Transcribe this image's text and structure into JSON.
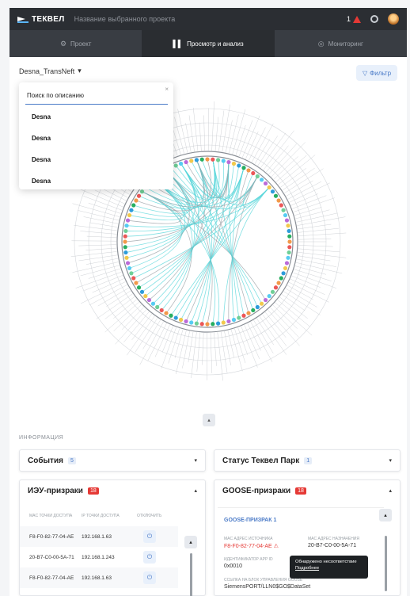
{
  "app": {
    "brand": "ТЕКВЕЛ",
    "project_name": "Название выбранного проекта",
    "alert_count": "1"
  },
  "nav": {
    "tabs": [
      {
        "label": "Проект"
      },
      {
        "label": "Просмотр и анализ"
      },
      {
        "label": "Мониторинг"
      }
    ]
  },
  "toolbar": {
    "project_select": "Desna_TransNeft",
    "filter_label": "Фильтр"
  },
  "search": {
    "placeholder": "Поиск по описанию",
    "options": [
      "Desna",
      "Desna",
      "Desna",
      "Desna"
    ]
  },
  "info": {
    "section_title": "ИНФОРМАЦИЯ",
    "events": {
      "title": "События",
      "count": "5"
    },
    "park_status": {
      "title": "Статус Теквел Парк",
      "count": "1"
    },
    "ied_ghosts": {
      "title": "ИЭУ-призраки",
      "count": "18",
      "columns": [
        "MAC ТОЧКИ ДОСТУПА",
        "IP ТОЧКИ ДОСТУПА",
        "ОТКЛЮЧИТЬ"
      ],
      "rows": [
        {
          "mac": "F8-F0-82-77-04-AE",
          "ip": "192.168.1.63"
        },
        {
          "mac": "20-B7-C0-00-5A-71",
          "ip": "192.168.1.243"
        },
        {
          "mac": "F8-F0-82-77-04-AE",
          "ip": "192.168.1.63"
        }
      ]
    },
    "goose_ghosts": {
      "title": "GOOSE-призраки",
      "count": "18",
      "item_title": "GOOSE-ПРИЗРАК 1",
      "src_label": "MAC АДРЕС ИСТОЧНИКА",
      "src_mac": "F8-F0-82-77-04-AE",
      "dst_label": "MAC АДРЕС НАЗНАЧЕНИЯ",
      "dst_mac": "20-B7-C0-00-5A-71",
      "appid_label": "ИДЕНТИФИКАТОР APP ID",
      "appid": "0x0010",
      "gcb_label": "ССЫЛКА НА БЛОК УПРАВЛЕНИЯ GOOSE",
      "gcb": "SiemensPORT/LLN0$GO$DataSet",
      "tooltip_text": "Обнаружено несоответствие",
      "tooltip_link": "Подробнее"
    }
  },
  "colors": {
    "topbar": "#2b2e33",
    "accent": "#4a7ac7",
    "alert": "#e53935",
    "chord_main": "#57d6d9"
  }
}
